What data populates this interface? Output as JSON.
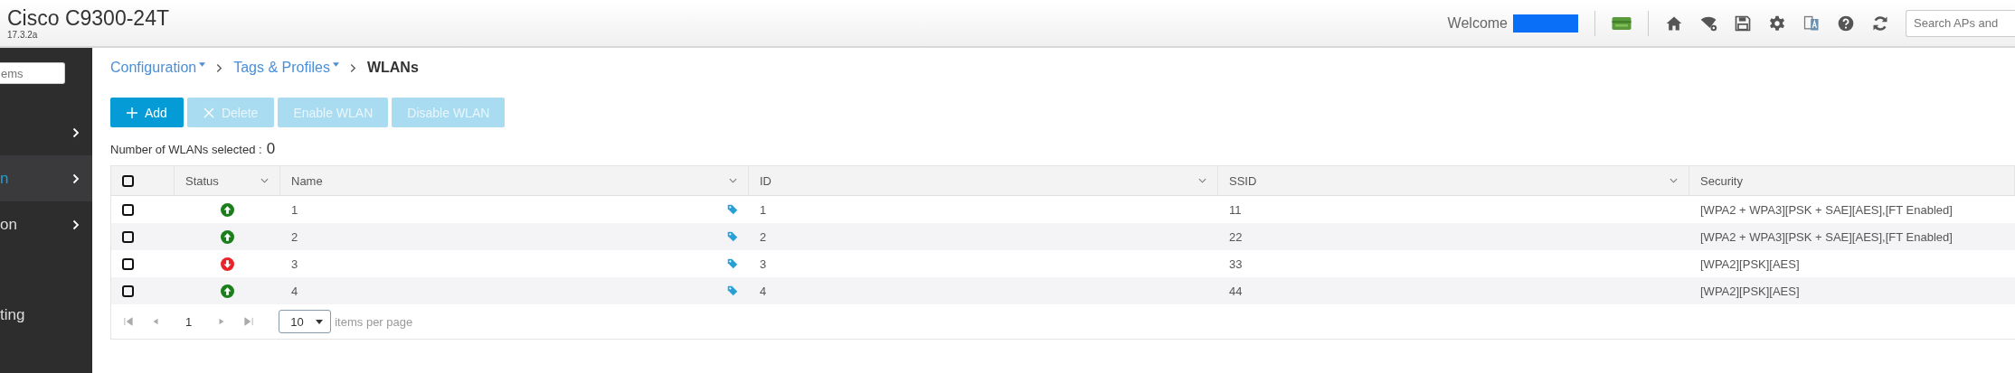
{
  "header": {
    "title": "Cisco C9300-24T",
    "version": "17.3.2a",
    "welcome": "Welcome",
    "search": {
      "placeholder": "Search APs and"
    }
  },
  "sidebar": {
    "search": {
      "placeholder": "ems"
    },
    "items": [
      {
        "selected": false,
        "expandable": true
      },
      {
        "label": "n",
        "selected": true,
        "expandable": true
      },
      {
        "label": "on",
        "selected": false,
        "expandable": true
      },
      {
        "label": "ting",
        "selected": false,
        "expandable": false
      }
    ]
  },
  "breadcrumb": [
    {
      "label": "Configuration",
      "kind": "menu"
    },
    {
      "label": "Tags & Profiles",
      "kind": "menu"
    },
    {
      "label": "WLANs",
      "kind": "current"
    }
  ],
  "buttons": [
    {
      "label": "Add",
      "kind": "add",
      "disabled": false
    },
    {
      "label": "Delete",
      "kind": "delete",
      "disabled": true
    },
    {
      "label": "Enable WLAN",
      "kind": "plain",
      "disabled": true
    },
    {
      "label": "Disable WLAN",
      "kind": "plain",
      "disabled": true
    }
  ],
  "selection": {
    "label": "Number of WLANs selected :",
    "count": "0"
  },
  "table": {
    "select_all": {
      "checked": false
    },
    "columns": [
      {
        "label": "Status",
        "sortable": true
      },
      {
        "label": "Name",
        "sortable": true
      },
      {
        "label": "ID",
        "sortable": true
      },
      {
        "label": "SSID",
        "sortable": true
      },
      {
        "label": "Security",
        "sortable": false
      }
    ],
    "rows": [
      {
        "checked": false,
        "up": true,
        "name": "1",
        "id": "1",
        "ssid": "11",
        "security": "[WPA2 + WPA3][PSK + SAE][AES],[FT Enabled]"
      },
      {
        "checked": false,
        "up": true,
        "name": "2",
        "id": "2",
        "ssid": "22",
        "security": "[WPA2 + WPA3][PSK + SAE][AES],[FT Enabled]"
      },
      {
        "checked": false,
        "up": false,
        "name": "3",
        "id": "3",
        "ssid": "33",
        "security": "[WPA2][PSK][AES]"
      },
      {
        "checked": false,
        "up": true,
        "name": "4",
        "id": "4",
        "ssid": "44",
        "security": "[WPA2][PSK][AES]"
      }
    ]
  },
  "pager": {
    "page": "1",
    "page_size": "10",
    "page_size_label": "items per page"
  }
}
